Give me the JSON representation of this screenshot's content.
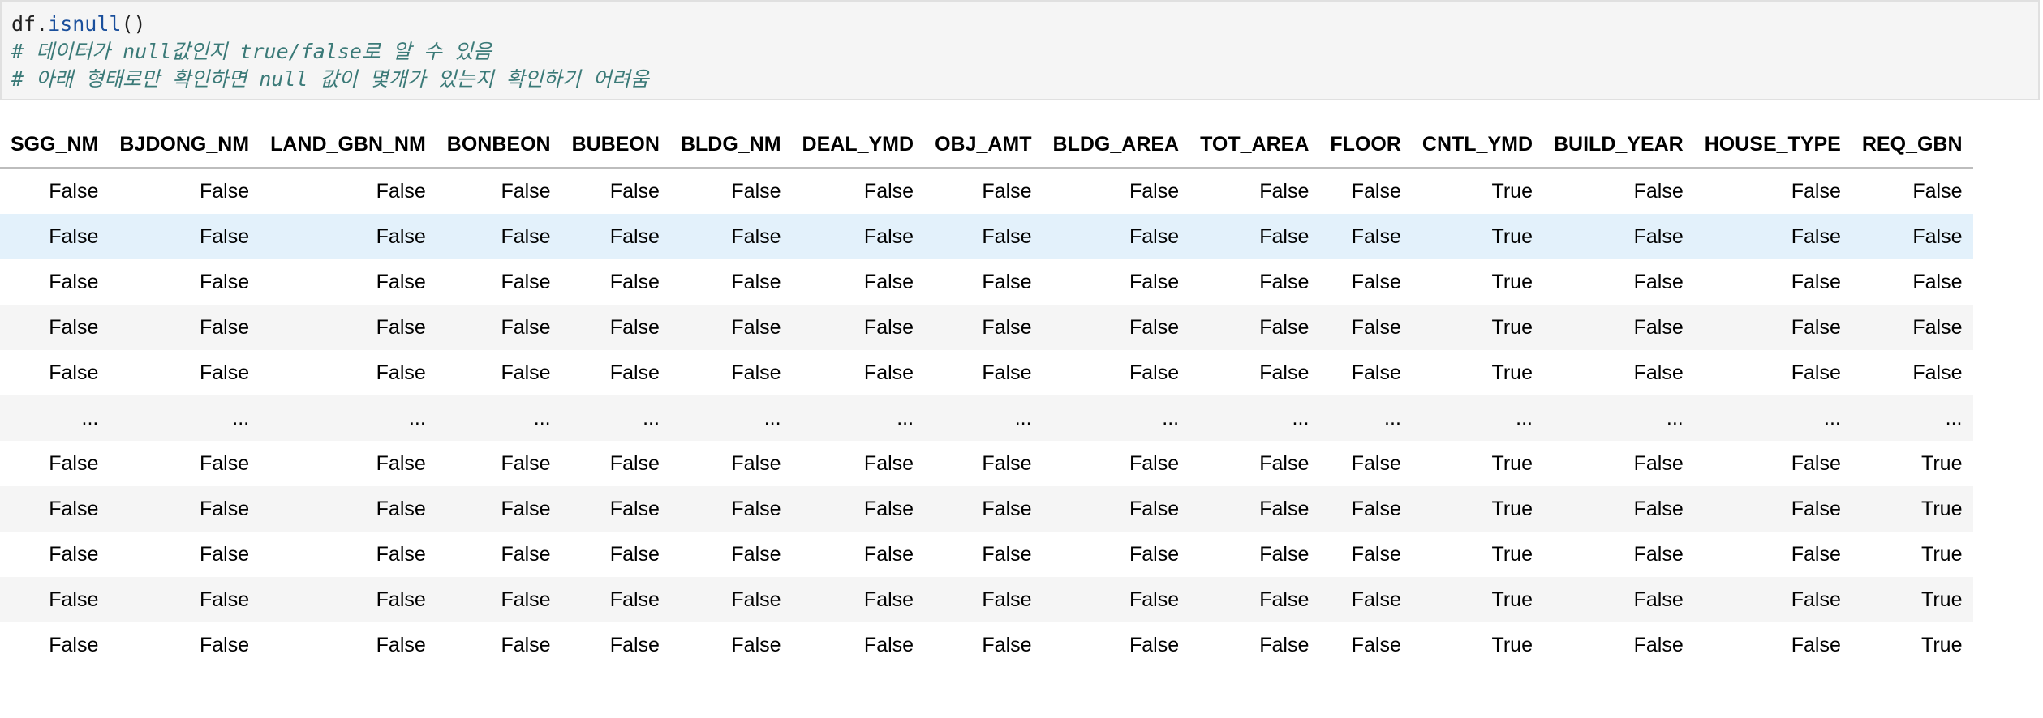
{
  "code_cell": {
    "lines": [
      {
        "obj": "df.",
        "fn": "isnull",
        "args": "()"
      },
      {
        "comment": "# 데이터가 null값인지 true/false로 알 수 있음"
      },
      {
        "comment": "# 아래 형태로만 확인하면 null 값이 몇개가 있는지 확인하기 어려움"
      }
    ]
  },
  "dataframe": {
    "columns": [
      "SGG_NM",
      "BJDONG_NM",
      "LAND_GBN_NM",
      "BONBEON",
      "BUBEON",
      "BLDG_NM",
      "DEAL_YMD",
      "OBJ_AMT",
      "BLDG_AREA",
      "TOT_AREA",
      "FLOOR",
      "CNTL_YMD",
      "BUILD_YEAR",
      "HOUSE_TYPE",
      "REQ_GBN"
    ],
    "rows": [
      [
        "False",
        "False",
        "False",
        "False",
        "False",
        "False",
        "False",
        "False",
        "False",
        "False",
        "False",
        "True",
        "False",
        "False",
        "False"
      ],
      [
        "False",
        "False",
        "False",
        "False",
        "False",
        "False",
        "False",
        "False",
        "False",
        "False",
        "False",
        "True",
        "False",
        "False",
        "False"
      ],
      [
        "False",
        "False",
        "False",
        "False",
        "False",
        "False",
        "False",
        "False",
        "False",
        "False",
        "False",
        "True",
        "False",
        "False",
        "False"
      ],
      [
        "False",
        "False",
        "False",
        "False",
        "False",
        "False",
        "False",
        "False",
        "False",
        "False",
        "False",
        "True",
        "False",
        "False",
        "False"
      ],
      [
        "False",
        "False",
        "False",
        "False",
        "False",
        "False",
        "False",
        "False",
        "False",
        "False",
        "False",
        "True",
        "False",
        "False",
        "False"
      ],
      [
        "...",
        "...",
        "...",
        "...",
        "...",
        "...",
        "...",
        "...",
        "...",
        "...",
        "...",
        "...",
        "...",
        "...",
        "..."
      ],
      [
        "False",
        "False",
        "False",
        "False",
        "False",
        "False",
        "False",
        "False",
        "False",
        "False",
        "False",
        "True",
        "False",
        "False",
        "True"
      ],
      [
        "False",
        "False",
        "False",
        "False",
        "False",
        "False",
        "False",
        "False",
        "False",
        "False",
        "False",
        "True",
        "False",
        "False",
        "True"
      ],
      [
        "False",
        "False",
        "False",
        "False",
        "False",
        "False",
        "False",
        "False",
        "False",
        "False",
        "False",
        "True",
        "False",
        "False",
        "True"
      ],
      [
        "False",
        "False",
        "False",
        "False",
        "False",
        "False",
        "False",
        "False",
        "False",
        "False",
        "False",
        "True",
        "False",
        "False",
        "True"
      ],
      [
        "False",
        "False",
        "False",
        "False",
        "False",
        "False",
        "False",
        "False",
        "False",
        "False",
        "False",
        "True",
        "False",
        "False",
        "True"
      ]
    ],
    "hover_row_index": 1
  }
}
